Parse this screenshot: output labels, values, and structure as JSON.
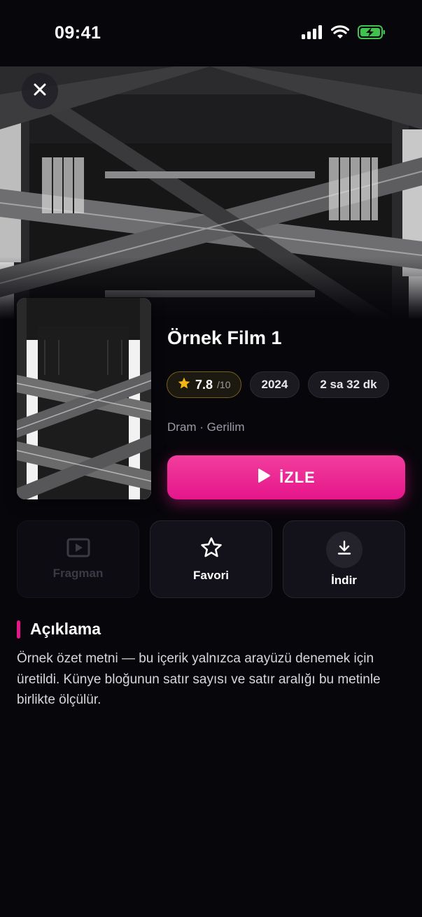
{
  "status_bar": {
    "time": "09:41"
  },
  "nav": {
    "close_icon": "close-icon"
  },
  "movie": {
    "title": "Örnek Film 1",
    "rating": "7.8",
    "rating_max": "/10",
    "year": "2024",
    "duration": "2 sa 32 dk",
    "genres": "Dram · Gerilim"
  },
  "watch_button": {
    "label": "İZLE"
  },
  "actions": {
    "trailer": "Fragman",
    "favorite": "Favori",
    "download": "İndir"
  },
  "description": {
    "heading": "Açıklama",
    "text": "Örnek özet metni — bu içerik yalnızca arayüzü denemek için üretildi. Künye bloğunun satır sayısı ve satır aralığı bu metinle birlikte ölçülür."
  },
  "colors": {
    "accent": "#e5168a",
    "star": "#f5b70f",
    "background": "#07060b"
  }
}
